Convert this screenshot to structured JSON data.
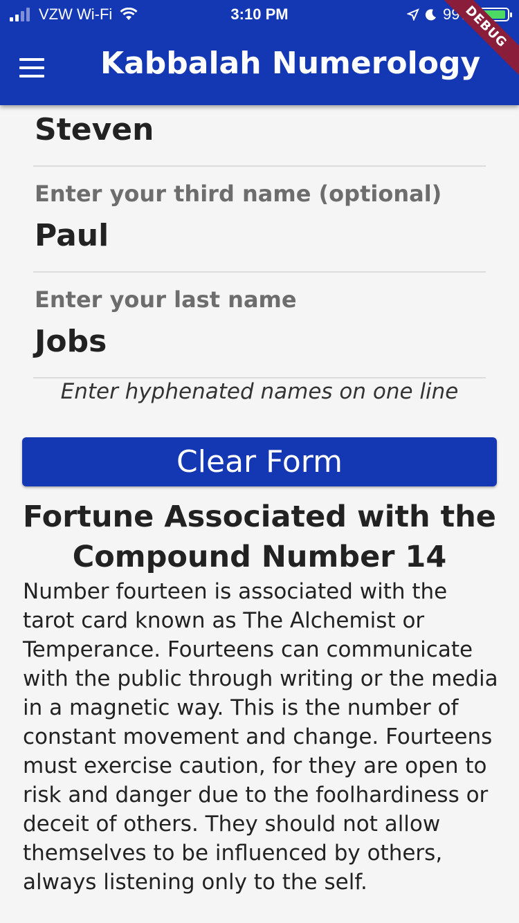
{
  "status_bar": {
    "carrier": "VZW Wi-Fi",
    "time": "3:10 PM",
    "battery": "99%",
    "icons": [
      "signal-icon",
      "wifi-icon",
      "location-icon",
      "moon-icon",
      "battery-icon"
    ]
  },
  "app_bar": {
    "title": "Kabbalah Numerology",
    "menu_icon": "hamburger-menu-icon",
    "color": "#1437b4"
  },
  "debug_banner": "DEBUG",
  "form": {
    "second_name_value": "Steven",
    "third_name_label": "Enter your third name (optional)",
    "third_name_value": "Paul",
    "last_name_label": "Enter your last name",
    "last_name_value": "Jobs",
    "hint": "Enter hyphenated names on one line",
    "clear_button": "Clear Form"
  },
  "fortune": {
    "title": "Fortune Associated with the Compound Number 14",
    "body": "Number fourteen is associated with the tarot card known as The Alchemist or Temperance. Fourteens can communicate with the public through writing or the media in a magnetic way. This is the number of constant movement and change. Fourteens must exercise caution, for they are open to risk and danger due to the foolhardiness or deceit of others. They should not allow themselves to be influenced by others, always listening only to the self."
  }
}
